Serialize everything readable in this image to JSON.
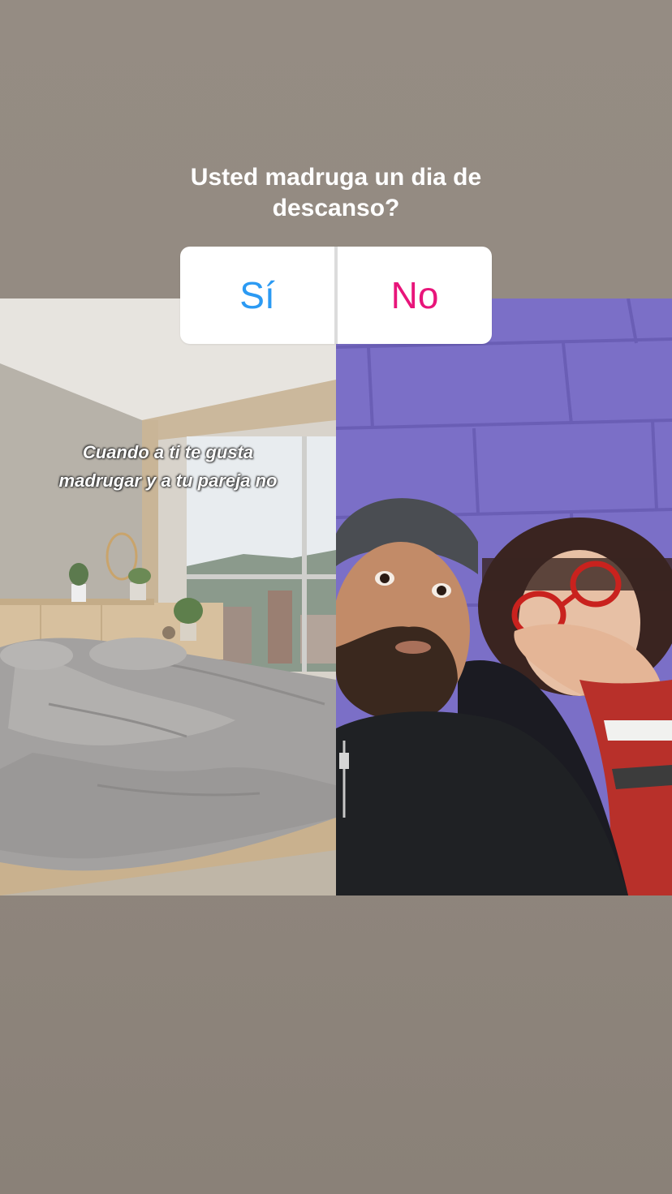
{
  "story": {
    "question_lines": [
      "Usted madruga un dia de",
      "descanso?"
    ],
    "poll": {
      "yes_label": "Sí",
      "no_label": "No",
      "yes_color": "#2b9af3",
      "no_color": "#e8157a"
    },
    "left_caption_lines": [
      "Cuando a ti te gusta",
      "madrugar y a tu pareja no"
    ]
  }
}
